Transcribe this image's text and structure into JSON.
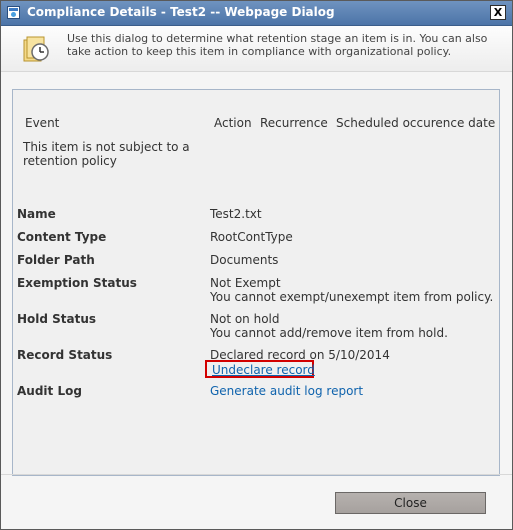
{
  "window": {
    "title": "Compliance Details - Test2 -- Webpage Dialog",
    "close_glyph": "X",
    "icon": "ie-page-icon"
  },
  "banner": {
    "icon": "compliance-clock-icon",
    "text": "Use this dialog to determine what retention stage an item is in. You can also take action to keep this item in compliance with organizational policy."
  },
  "events": {
    "headers": [
      "Event",
      "Action",
      "Recurrence",
      "Scheduled occurence date"
    ],
    "message": "This item is not subject to a retention policy"
  },
  "details": {
    "name_label": "Name",
    "name_value": "Test2.txt",
    "content_type_label": "Content Type",
    "content_type_value": "RootContType",
    "folder_path_label": "Folder Path",
    "folder_path_value": "Documents",
    "exemption_label": "Exemption Status",
    "exemption_value": "Not Exempt",
    "exemption_note": "You cannot exempt/unexempt item from policy.",
    "hold_label": "Hold Status",
    "hold_value": "Not on hold",
    "hold_note": "You cannot add/remove item from hold.",
    "record_label": "Record Status",
    "record_value": "Declared record on 5/10/2014",
    "undeclare_link": "Undeclare record",
    "audit_label": "Audit Log",
    "audit_link": "Generate audit log report"
  },
  "footer": {
    "close_label": "Close"
  },
  "colors": {
    "link": "#0f63ad",
    "highlight_box": "#d20000",
    "titlebar": "#4c74a8"
  }
}
